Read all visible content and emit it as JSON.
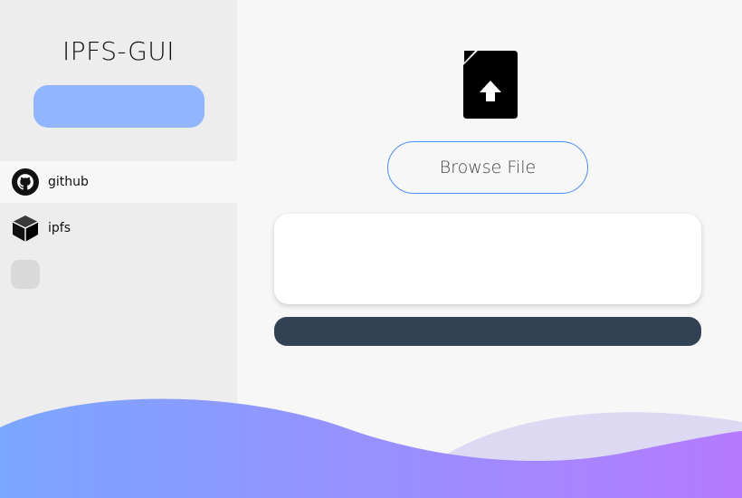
{
  "app": {
    "title": "IPFS-GUI"
  },
  "sidebar": {
    "items": [
      {
        "label": "github",
        "icon": "github-icon",
        "active": true
      },
      {
        "label": "ipfs",
        "icon": "cube-icon",
        "active": false
      }
    ]
  },
  "main": {
    "upload_icon": "file-upload-icon",
    "browse_label": "Browse File"
  },
  "colors": {
    "sidebar_bg": "#ededed",
    "sidebar_button": "#91b6ff",
    "browse_border": "#4e8ff2",
    "action_bar": "#334155",
    "wave_start": "#7aa7ff",
    "wave_end": "#b57aff",
    "wave_back": "#ded9f3"
  }
}
